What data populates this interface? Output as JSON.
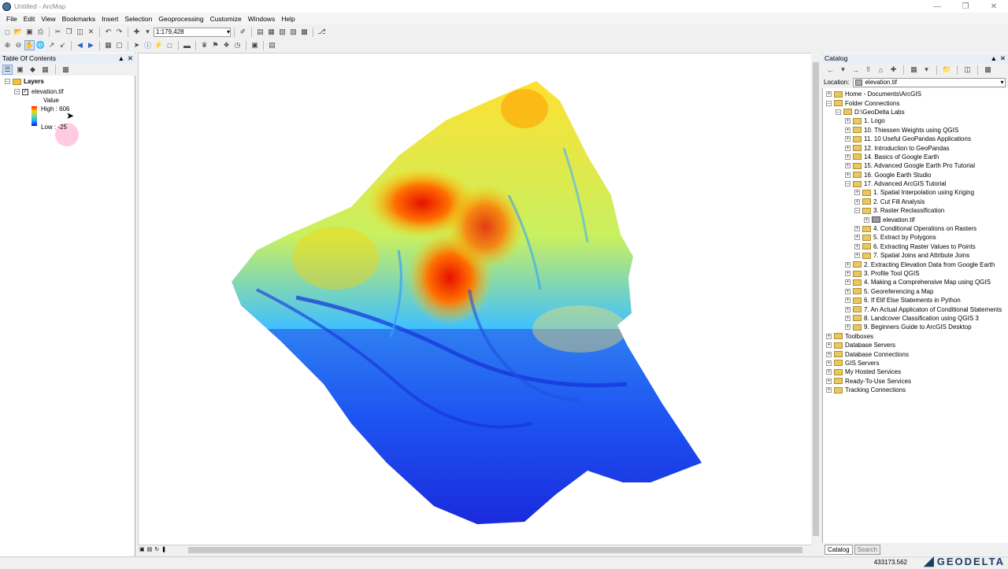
{
  "window": {
    "title": "Untitled - ArcMap"
  },
  "menu": [
    "File",
    "Edit",
    "View",
    "Bookmarks",
    "Insert",
    "Selection",
    "Geoprocessing",
    "Customize",
    "Windows",
    "Help"
  ],
  "toolbar": {
    "scale": "1:179,428"
  },
  "toc": {
    "title": "Table Of Contents",
    "layers_label": "Layers",
    "layer_name": "elevation.tif",
    "legend_title": "Value",
    "high_label": "High : 606",
    "low_label": "Low : -25"
  },
  "catalog": {
    "title": "Catalog",
    "location_label": "Location:",
    "location_value": "elevation.tif",
    "tree": [
      {
        "label": "Home - Documents\\ArcGIS",
        "level": 0,
        "exp": "+"
      },
      {
        "label": "Folder Connections",
        "level": 0,
        "exp": "-"
      },
      {
        "label": "D:\\GeoDelta Labs",
        "level": 1,
        "exp": "-"
      },
      {
        "label": "1. Logo",
        "level": 2,
        "exp": "+"
      },
      {
        "label": "10. Thiessen Weights using QGIS",
        "level": 2,
        "exp": "+"
      },
      {
        "label": "11. 10 Useful GeoPandas Applications",
        "level": 2,
        "exp": "+"
      },
      {
        "label": "12. Introduction to GeoPandas",
        "level": 2,
        "exp": "+"
      },
      {
        "label": "14. Basics of Google Earth",
        "level": 2,
        "exp": "+"
      },
      {
        "label": "15. Advanced Google Earth Pro Tutorial",
        "level": 2,
        "exp": "+"
      },
      {
        "label": "16. Google Earth Studio",
        "level": 2,
        "exp": "+"
      },
      {
        "label": "17. Advanced ArcGIS Tutorial",
        "level": 2,
        "exp": "-"
      },
      {
        "label": "1. Spatial Interpolation using Kriging",
        "level": 3,
        "exp": "+"
      },
      {
        "label": "2. Cut Fill Analysis",
        "level": 3,
        "exp": "+"
      },
      {
        "label": "3. Raster Reclassification",
        "level": 3,
        "exp": "-"
      },
      {
        "label": "elevation.tif",
        "level": 4,
        "exp": "+",
        "raster": true
      },
      {
        "label": "4. Conditional Operations on Rasters",
        "level": 3,
        "exp": "+"
      },
      {
        "label": "5. Extract by Polygons",
        "level": 3,
        "exp": "+"
      },
      {
        "label": "6. Extracting Raster Values to Points",
        "level": 3,
        "exp": "+"
      },
      {
        "label": "7. Spatial Joins and Attribute Joins",
        "level": 3,
        "exp": "+"
      },
      {
        "label": "2. Extracting Elevation Data from Google Earth",
        "level": 2,
        "exp": "+"
      },
      {
        "label": "3. Profile Tool QGIS",
        "level": 2,
        "exp": "+"
      },
      {
        "label": "4. Making a Comprehensive Map using QGIS",
        "level": 2,
        "exp": "+"
      },
      {
        "label": "5. Georeferencing a Map",
        "level": 2,
        "exp": "+"
      },
      {
        "label": "6. If Elif Else Statements in Python",
        "level": 2,
        "exp": "+"
      },
      {
        "label": "7. An Actual Applicaton of Conditional Statements",
        "level": 2,
        "exp": "+"
      },
      {
        "label": "8. Landcover Classification using QGIS 3",
        "level": 2,
        "exp": "+"
      },
      {
        "label": "9. Beginners Guide to ArcGIS Desktop",
        "level": 2,
        "exp": "+"
      },
      {
        "label": "Toolboxes",
        "level": 0,
        "exp": "+"
      },
      {
        "label": "Database Servers",
        "level": 0,
        "exp": "+"
      },
      {
        "label": "Database Connections",
        "level": 0,
        "exp": "+"
      },
      {
        "label": "GIS Servers",
        "level": 0,
        "exp": "+"
      },
      {
        "label": "My Hosted Services",
        "level": 0,
        "exp": "+"
      },
      {
        "label": "Ready-To-Use Services",
        "level": 0,
        "exp": "+"
      },
      {
        "label": "Tracking Connections",
        "level": 0,
        "exp": "+"
      }
    ],
    "tab_catalog": "Catalog",
    "tab_search": "Search"
  },
  "status": {
    "coordinates": "433173.562"
  },
  "logo": {
    "text": "GEODELTA"
  },
  "colors": {
    "high": "#ff2000",
    "mid": "#ffe030",
    "low": "#1010d0"
  }
}
